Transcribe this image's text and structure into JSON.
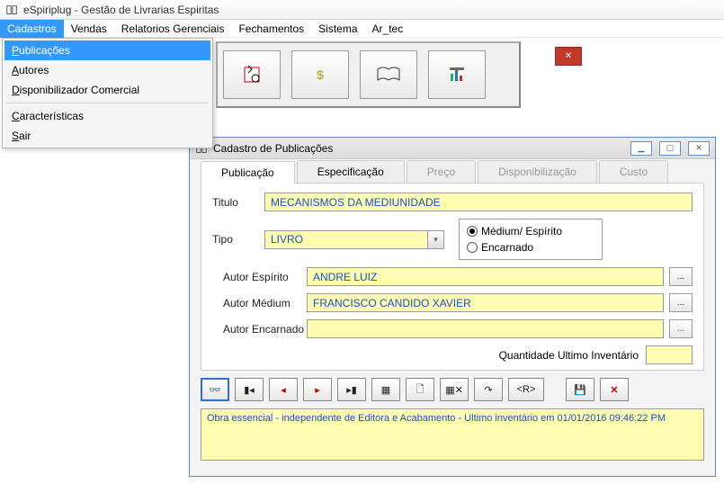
{
  "app": {
    "title": "eSpiriplug - Gestão de Livrarias Espiritas"
  },
  "menubar": {
    "items": [
      "Cadastros",
      "Vendas",
      "Relatorios Gerenciais",
      "Fechamentos",
      "Sistema",
      "Ar_tec"
    ]
  },
  "dropdown": {
    "items": [
      {
        "underline": "P",
        "rest": "ublicações"
      },
      {
        "underline": "A",
        "rest": "utores"
      },
      {
        "underline": "D",
        "rest": "isponibilizador Comercial"
      }
    ],
    "group2": [
      {
        "underline": "C",
        "rest": "aracterísticas"
      },
      {
        "underline": "S",
        "rest": "air"
      }
    ]
  },
  "child": {
    "title": "Cadastro de Publicações",
    "tabs": [
      "Publicação",
      "Especificação",
      "Preço",
      "Disponibilização",
      "Custo"
    ],
    "labels": {
      "titulo": "Titulo",
      "tipo": "Tipo",
      "autor_espirito": "Autor Espírito",
      "autor_medium": "Autor Médium",
      "autor_encarnado": "Autor Encarnado",
      "qtd": "Quantidade Ultimo Inventário"
    },
    "values": {
      "titulo": "MECANISMOS DA MEDIUNIDADE",
      "tipo": "LIVRO",
      "autor_espirito": "ANDRE LUIZ",
      "autor_medium": "FRANCISCO CANDIDO XAVIER",
      "autor_encarnado": "",
      "qtd": ""
    },
    "radios": {
      "medium": "Médium/ Espírito",
      "encarnado": "Encarnado"
    },
    "nav": {
      "r_btn": "<R>"
    },
    "status": "Obra essencial - independente de Editora e Acabamento  - Ultimo inventário em 01/01/2016 09:46:22 PM"
  }
}
